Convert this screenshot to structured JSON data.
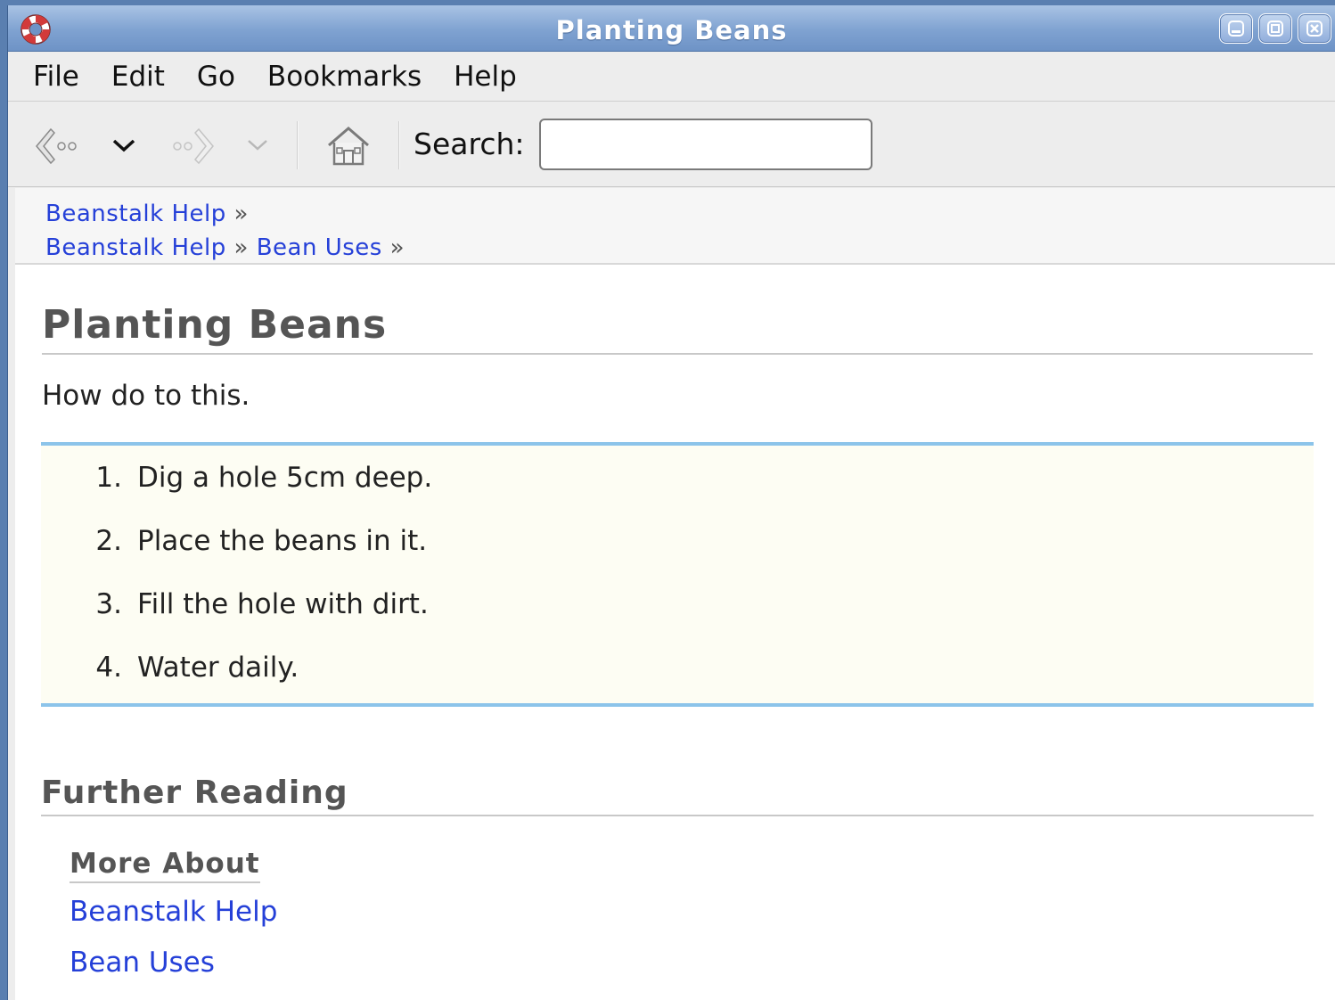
{
  "window": {
    "title": "Planting Beans"
  },
  "menubar": [
    "File",
    "Edit",
    "Go",
    "Bookmarks",
    "Help"
  ],
  "toolbar": {
    "search_label": "Search:",
    "search_value": "",
    "search_placeholder": ""
  },
  "trails": [
    {
      "links": [
        "Beanstalk Help"
      ],
      "separator": "»"
    },
    {
      "links": [
        "Beanstalk Help",
        "Bean Uses"
      ],
      "separator": "»"
    }
  ],
  "page": {
    "title": "Planting Beans",
    "intro": "How do to this.",
    "steps": [
      {
        "num": "1.",
        "text": "Dig a hole 5cm deep."
      },
      {
        "num": "2.",
        "text": "Place the beans in it."
      },
      {
        "num": "3.",
        "text": "Fill the hole with dirt."
      },
      {
        "num": "4.",
        "text": "Water daily."
      }
    ],
    "further_reading": {
      "heading": "Further Reading",
      "subheading": "More About",
      "links": [
        "Beanstalk Help",
        "Bean Uses"
      ]
    }
  },
  "icons": {
    "app": "help-lifebuoy-icon",
    "back": "back-arrow-icon",
    "forward": "forward-arrow-icon",
    "home": "home-icon"
  },
  "colors": {
    "link": "#2540d8",
    "steps_border": "#8cc4ea",
    "steps_bg": "#fdfdf3"
  }
}
